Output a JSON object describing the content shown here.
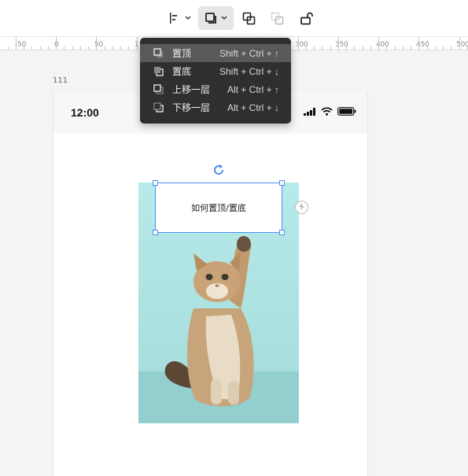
{
  "toolbar": {
    "tools": [
      {
        "icon": "align-left-icon",
        "has_dropdown": true
      },
      {
        "icon": "layer-order-icon",
        "has_dropdown": true,
        "active": true
      },
      {
        "icon": "group-icon"
      },
      {
        "icon": "ungroup-icon",
        "disabled": true
      },
      {
        "icon": "unlock-icon"
      }
    ]
  },
  "ruler": {
    "labels": [
      "-50",
      "0",
      "50",
      "1",
      "300",
      "350",
      "400",
      "450",
      "500"
    ]
  },
  "layer_menu": {
    "items": [
      {
        "label": "置顶",
        "shortcut": "Shift + Ctrl + ↑",
        "icon": "bring-to-front-icon"
      },
      {
        "label": "置底",
        "shortcut": "Shift + Ctrl + ↓",
        "icon": "send-to-back-icon"
      },
      {
        "label": "上移一层",
        "shortcut": "Alt + Ctrl + ↑",
        "icon": "bring-forward-icon"
      },
      {
        "label": "下移一层",
        "shortcut": "Alt + Ctrl + ↓",
        "icon": "send-backward-icon"
      }
    ]
  },
  "canvas": {
    "frame_label": "111",
    "status_time": "12:00",
    "textbox_text": "如何置顶/置底",
    "photo_subject": "kitten-photo"
  },
  "colors": {
    "accent": "#4a90f0",
    "menu_bg": "#2f2f2f",
    "menu_hover": "#595959",
    "photo_bg": "#aee0df"
  }
}
